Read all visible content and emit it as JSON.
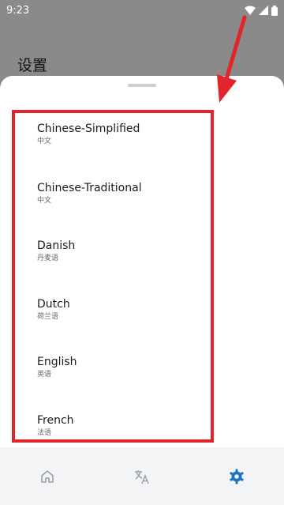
{
  "status_bar": {
    "time": "9:23"
  },
  "page": {
    "title": "设置"
  },
  "languages": [
    {
      "name": "Chinese-Simplified",
      "native": "中文"
    },
    {
      "name": "Chinese-Traditional",
      "native": "中文"
    },
    {
      "name": "Danish",
      "native": "丹麦语"
    },
    {
      "name": "Dutch",
      "native": "荷兰语"
    },
    {
      "name": "English",
      "native": "英语"
    },
    {
      "name": "French",
      "native": "法语"
    }
  ],
  "bottom_nav": [
    {
      "icon": "home-icon",
      "active": false
    },
    {
      "icon": "translate-icon",
      "active": false
    },
    {
      "icon": "gear-icon",
      "active": true
    }
  ],
  "colors": {
    "accent": "#1a73c6",
    "highlight": "#e2242b",
    "scrim": "#8a8a8a",
    "nav_inactive": "#9aa0a6"
  }
}
